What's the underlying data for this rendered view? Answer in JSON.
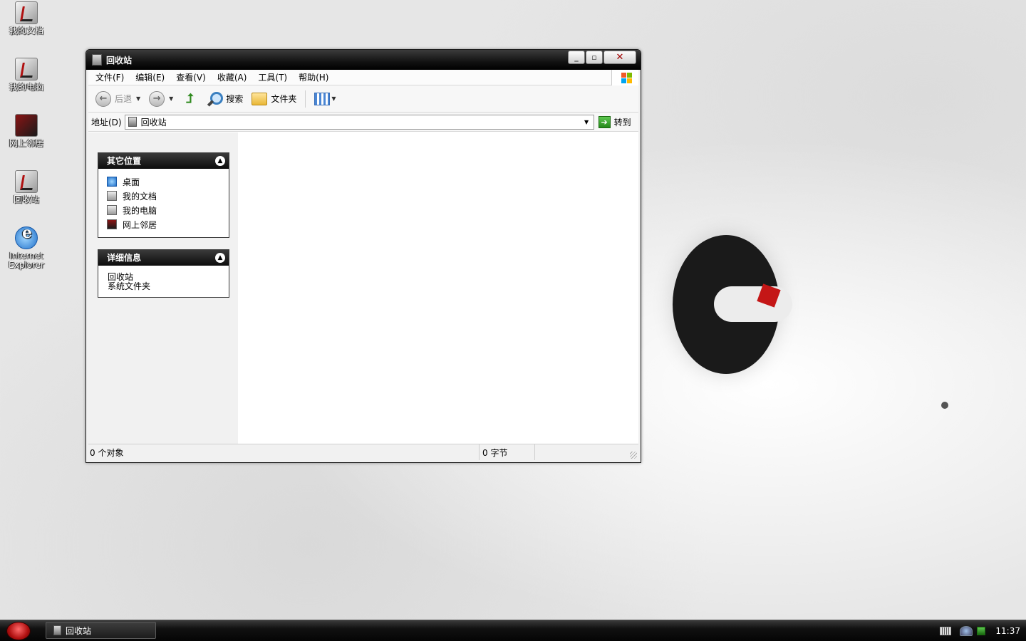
{
  "desktop": {
    "icons": [
      {
        "label": "我的文档"
      },
      {
        "label": "我的电脑"
      },
      {
        "label": "网上邻居"
      },
      {
        "label": "回收站"
      },
      {
        "label": "Internet Explorer"
      }
    ]
  },
  "window": {
    "title": "回收站",
    "controls": {
      "minimize": "_",
      "restore": "▫",
      "close": "✕"
    },
    "menu": [
      "文件(F)",
      "编辑(E)",
      "查看(V)",
      "收藏(A)",
      "工具(T)",
      "帮助(H)"
    ],
    "toolbar": {
      "back_label": "后退",
      "search_label": "搜索",
      "folders_label": "文件夹"
    },
    "address": {
      "label": "地址(D)",
      "value": "回收站",
      "go_label": "转到"
    },
    "taskpane": {
      "other_places": {
        "title": "其它位置",
        "links": [
          "桌面",
          "我的文档",
          "我的电脑",
          "网上邻居"
        ]
      },
      "details": {
        "title": "详细信息",
        "name": "回收站",
        "type": "系统文件夹"
      }
    },
    "status": {
      "objects": "0 个对象",
      "size": "0 字节"
    }
  },
  "taskbar": {
    "task_title": "回收站",
    "clock": "11:37"
  },
  "colors": {
    "titlebar": "#121212",
    "taskbar": "#111111",
    "start_button": "#b01010",
    "go_button": "#24881a"
  }
}
